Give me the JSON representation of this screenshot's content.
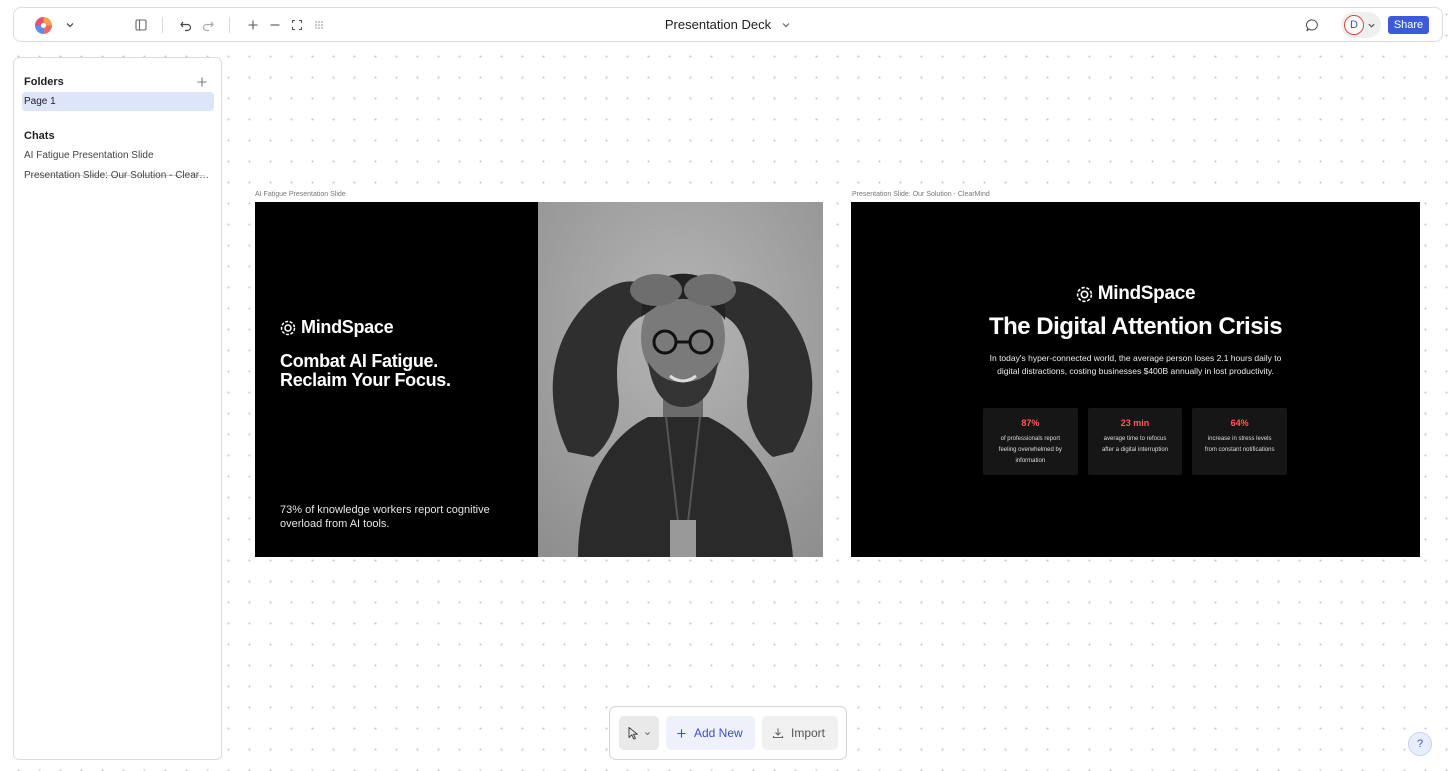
{
  "topbar": {
    "doc_title": "Presentation Deck",
    "share_label": "Share",
    "avatar_initial": "D",
    "icons": [
      "app-logo-icon",
      "chevron-down-icon",
      "sidebar-toggle-icon",
      "undo-icon",
      "redo-icon",
      "zoom-in-icon",
      "zoom-out-icon",
      "fit-to-screen-icon",
      "grid-icon",
      "comment-icon"
    ]
  },
  "sidebar": {
    "folders_heading": "Folders",
    "folders": [
      {
        "label": "Page 1",
        "active": true
      }
    ],
    "chats_heading": "Chats",
    "chats": [
      {
        "label": "AI Fatigue Presentation Slide"
      },
      {
        "label": "Presentation Slide: Our Solution - ClearMind"
      }
    ]
  },
  "canvas": {
    "frames": [
      {
        "label": "AI Fatigue Presentation Slide",
        "brand": "MindSpace",
        "headline_1": "Combat AI Fatigue.",
        "headline_2": "Reclaim Your Focus.",
        "footnote": "73% of knowledge workers report cognitive overload from AI tools.",
        "image_alt": "Stressed man holding his head"
      },
      {
        "label": "Presentation Slide: Our Solution - ClearMind",
        "brand": "MindSpace",
        "title": "The Digital Attention Crisis",
        "body": "In today's hyper-connected world, the average person loses 2.1 hours daily to digital distractions, costing businesses $400B annually in lost productivity.",
        "stats": [
          {
            "value": "87%",
            "label": "of professionals report feeling overwhelmed by information"
          },
          {
            "value": "23 min",
            "label": "average time to refocus after a digital interruption"
          },
          {
            "value": "64%",
            "label": "increase in stress levels from constant notifications"
          }
        ]
      }
    ]
  },
  "bottombar": {
    "add_label": "Add New",
    "import_label": "Import"
  },
  "help_label": "?",
  "colors": {
    "accent": "#3b5bdb",
    "stat_value": "#ff5a57",
    "sidebar_active": "#dde5f9"
  }
}
